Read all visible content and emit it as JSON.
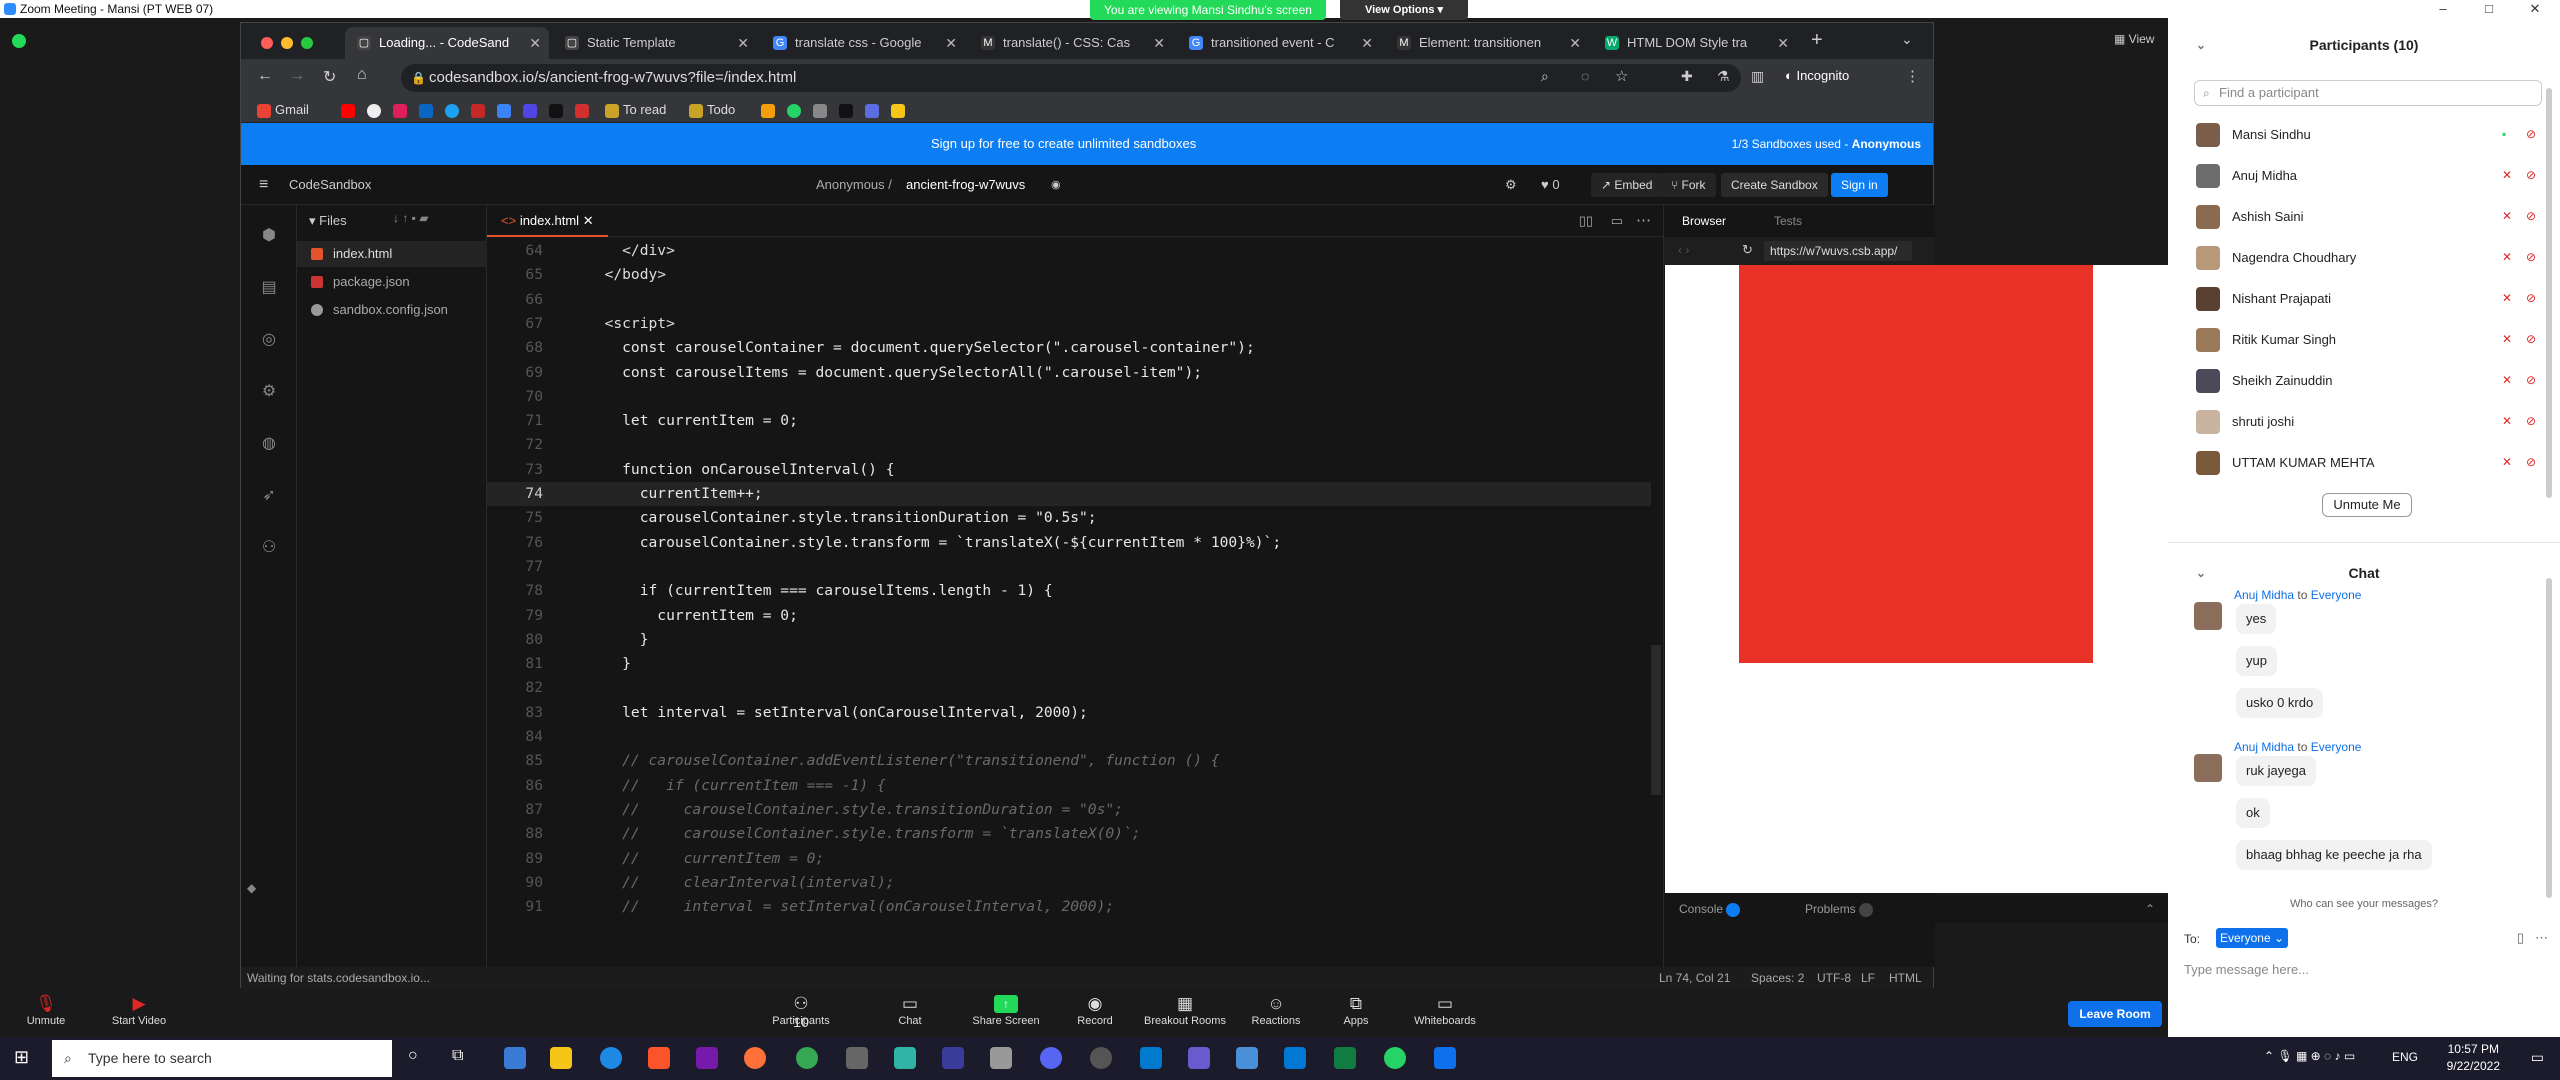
{
  "zoom": {
    "window_title": "Zoom Meeting - Mansi (PT WEB 07)",
    "viewing_banner": "You are viewing Mansi Sindhu's screen",
    "view_options": "View Options",
    "view_label": "View",
    "toolbar": {
      "unmute": "Unmute",
      "start_video": "Start Video",
      "participants": "Participants",
      "participants_count": "10",
      "chat": "Chat",
      "share_screen": "Share Screen",
      "record": "Record",
      "breakout": "Breakout Rooms",
      "reactions": "Reactions",
      "apps": "Apps",
      "whiteboards": "Whiteboards",
      "leave": "Leave Room"
    }
  },
  "browser": {
    "tabs": [
      {
        "title": "Loading... - CodeSand",
        "icon": "csb"
      },
      {
        "title": "Static Template",
        "icon": "csb"
      },
      {
        "title": "translate css - Google",
        "icon": "google"
      },
      {
        "title": "translate() - CSS: Cas",
        "icon": "mdn"
      },
      {
        "title": "transitioned event - C",
        "icon": "google"
      },
      {
        "title": "Element: transitionen",
        "icon": "mdn"
      },
      {
        "title": "HTML DOM Style tra",
        "icon": "w3"
      }
    ],
    "url": "codesandbox.io/s/ancient-frog-w7wuvs?file=/index.html",
    "incognito": "Incognito",
    "bookmarks": [
      "Gmail",
      "To read",
      "Todo"
    ],
    "status": "Waiting for stats.codesandbox.io..."
  },
  "csb": {
    "banner": "Sign up for free to create unlimited sandboxes",
    "sandboxes_used": "1/3 Sandboxes used",
    "sandboxes_user": "Anonymous",
    "brand": "CodeSandbox",
    "owner": "Anonymous /",
    "sandbox_name": "ancient-frog-w7wuvs",
    "likes": "0",
    "embed": "Embed",
    "fork": "Fork",
    "create": "Create Sandbox",
    "signin": "Sign in",
    "files_title": "Files",
    "files": [
      "index.html",
      "package.json",
      "sandbox.config.json"
    ],
    "editor_tab": "index.html",
    "preview_tabs": [
      "Browser",
      "Tests"
    ],
    "preview_url": "https://w7wuvs.csb.app/",
    "console": "Console",
    "problems": "Problems",
    "status": {
      "pos": "Ln 74, Col 21",
      "spaces": "Spaces: 2",
      "enc": "UTF-8",
      "eol": "LF",
      "lang": "HTML"
    }
  },
  "code_lines": [
    {
      "n": "64",
      "t": "    </div>"
    },
    {
      "n": "65",
      "t": "  </body>"
    },
    {
      "n": "66",
      "t": ""
    },
    {
      "n": "67",
      "t": "  <script>"
    },
    {
      "n": "68",
      "t": "    const carouselContainer = document.querySelector(\".carousel-container\");"
    },
    {
      "n": "69",
      "t": "    const carouselItems = document.querySelectorAll(\".carousel-item\");"
    },
    {
      "n": "70",
      "t": ""
    },
    {
      "n": "71",
      "t": "    let currentItem = 0;"
    },
    {
      "n": "72",
      "t": ""
    },
    {
      "n": "73",
      "t": "    function onCarouselInterval() {"
    },
    {
      "n": "74",
      "t": "      currentItem++;"
    },
    {
      "n": "75",
      "t": "      carouselContainer.style.transitionDuration = \"0.5s\";"
    },
    {
      "n": "76",
      "t": "      carouselContainer.style.transform = `translateX(-${currentItem * 100}%)`;"
    },
    {
      "n": "77",
      "t": ""
    },
    {
      "n": "78",
      "t": "      if (currentItem === carouselItems.length - 1) {"
    },
    {
      "n": "79",
      "t": "        currentItem = 0;"
    },
    {
      "n": "80",
      "t": "      }"
    },
    {
      "n": "81",
      "t": "    }"
    },
    {
      "n": "82",
      "t": ""
    },
    {
      "n": "83",
      "t": "    let interval = setInterval(onCarouselInterval, 2000);"
    },
    {
      "n": "84",
      "t": ""
    },
    {
      "n": "85",
      "t": "    // carouselContainer.addEventListener(\"transitionend\", function () {"
    },
    {
      "n": "86",
      "t": "    //   if (currentItem === -1) {"
    },
    {
      "n": "87",
      "t": "    //     carouselContainer.style.transitionDuration = \"0s\";"
    },
    {
      "n": "88",
      "t": "    //     carouselContainer.style.transform = `translateX(0)`;"
    },
    {
      "n": "89",
      "t": "    //     currentItem = 0;"
    },
    {
      "n": "90",
      "t": "    //     clearInterval(interval);"
    },
    {
      "n": "91",
      "t": "    //     interval = setInterval(onCarouselInterval, 2000);"
    }
  ],
  "current_line": "74",
  "participants": {
    "title": "Participants (10)",
    "search_placeholder": "Find a participant",
    "list": [
      "Mansi Sindhu",
      "Anuj Midha",
      "Ashish Saini",
      "Nagendra Choudhary",
      "Nishant Prajapati",
      "Ritik Kumar Singh",
      "Sheikh Zainuddin",
      "shruti joshi",
      "UTTAM KUMAR MEHTA"
    ],
    "unmute_me": "Unmute Me"
  },
  "chat": {
    "title": "Chat",
    "groups": [
      {
        "from": "Anuj Midha",
        "to": "to",
        "target": "Everyone",
        "messages": [
          "yes",
          "yup",
          "usko 0 krdo"
        ]
      },
      {
        "from": "Anuj Midha",
        "to": "to",
        "target": "Everyone",
        "messages": [
          "ruk jayega",
          "ok",
          "bhaag bhhag ke peeche ja rha"
        ]
      }
    ],
    "who_can_see": "Who can see your messages?",
    "to_label": "To:",
    "recipient": "Everyone",
    "placeholder": "Type message here..."
  },
  "taskbar": {
    "search": "Type here to search",
    "lang": "ENG",
    "time": "10:57 PM",
    "date": "9/22/2022"
  },
  "colors": {
    "csb_banner": "#0c7df2",
    "preview_box": "#e93227",
    "zoom_blue": "#0e71eb",
    "share_green": "#23d959"
  }
}
